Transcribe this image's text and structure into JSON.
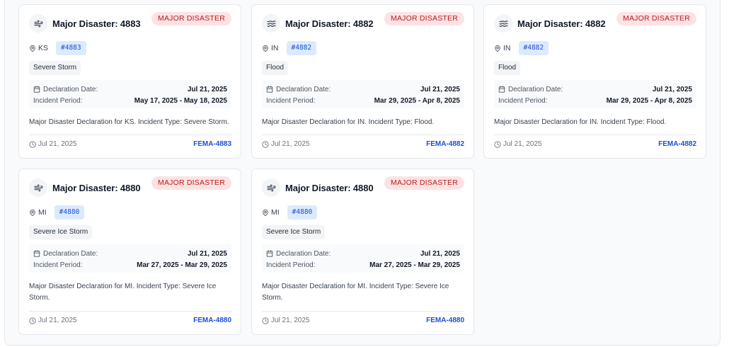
{
  "cards": [
    {
      "icon": "wind-icon",
      "title": "Major Disaster: 4883",
      "badge": "MAJOR DISASTER",
      "state": "KS",
      "id": "#4883",
      "type": "Severe Storm",
      "declaration_label": "Declaration Date:",
      "declaration_date": "Jul 21, 2025",
      "incident_label": "Incident Period:",
      "incident_period": "May 17, 2025 - May 18, 2025",
      "description": "Major Disaster Declaration for KS. Incident Type: Severe Storm.",
      "date": "Jul 21, 2025",
      "link": "FEMA-4883"
    },
    {
      "icon": "waves-icon",
      "title": "Major Disaster: 4882",
      "badge": "MAJOR DISASTER",
      "state": "IN",
      "id": "#4882",
      "type": "Flood",
      "declaration_label": "Declaration Date:",
      "declaration_date": "Jul 21, 2025",
      "incident_label": "Incident Period:",
      "incident_period": "Mar 29, 2025 - Apr 8, 2025",
      "description": "Major Disaster Declaration for IN. Incident Type: Flood.",
      "date": "Jul 21, 2025",
      "link": "FEMA-4882"
    },
    {
      "icon": "waves-icon",
      "title": "Major Disaster: 4882",
      "badge": "MAJOR DISASTER",
      "state": "IN",
      "id": "#4882",
      "type": "Flood",
      "declaration_label": "Declaration Date:",
      "declaration_date": "Jul 21, 2025",
      "incident_label": "Incident Period:",
      "incident_period": "Mar 29, 2025 - Apr 8, 2025",
      "description": "Major Disaster Declaration for IN. Incident Type: Flood.",
      "date": "Jul 21, 2025",
      "link": "FEMA-4882"
    },
    {
      "icon": "wind-icon",
      "title": "Major Disaster: 4880",
      "badge": "MAJOR DISASTER",
      "state": "MI",
      "id": "#4880",
      "type": "Severe Ice Storm",
      "declaration_label": "Declaration Date:",
      "declaration_date": "Jul 21, 2025",
      "incident_label": "Incident Period:",
      "incident_period": "Mar 27, 2025 - Mar 29, 2025",
      "description": "Major Disaster Declaration for MI. Incident Type: Severe Ice Storm.",
      "date": "Jul 21, 2025",
      "link": "FEMA-4880"
    },
    {
      "icon": "wind-icon",
      "title": "Major Disaster: 4880",
      "badge": "MAJOR DISASTER",
      "state": "MI",
      "id": "#4880",
      "type": "Severe Ice Storm",
      "declaration_label": "Declaration Date:",
      "declaration_date": "Jul 21, 2025",
      "incident_label": "Incident Period:",
      "incident_period": "Mar 27, 2025 - Mar 29, 2025",
      "description": "Major Disaster Declaration for MI. Incident Type: Severe Ice Storm.",
      "date": "Jul 21, 2025",
      "link": "FEMA-4880"
    }
  ],
  "colors": {
    "badge_bg": "#fde2e4",
    "badge_text": "#b91c1c",
    "chip_bg": "#dbeafe",
    "link": "#1d4ed8"
  }
}
